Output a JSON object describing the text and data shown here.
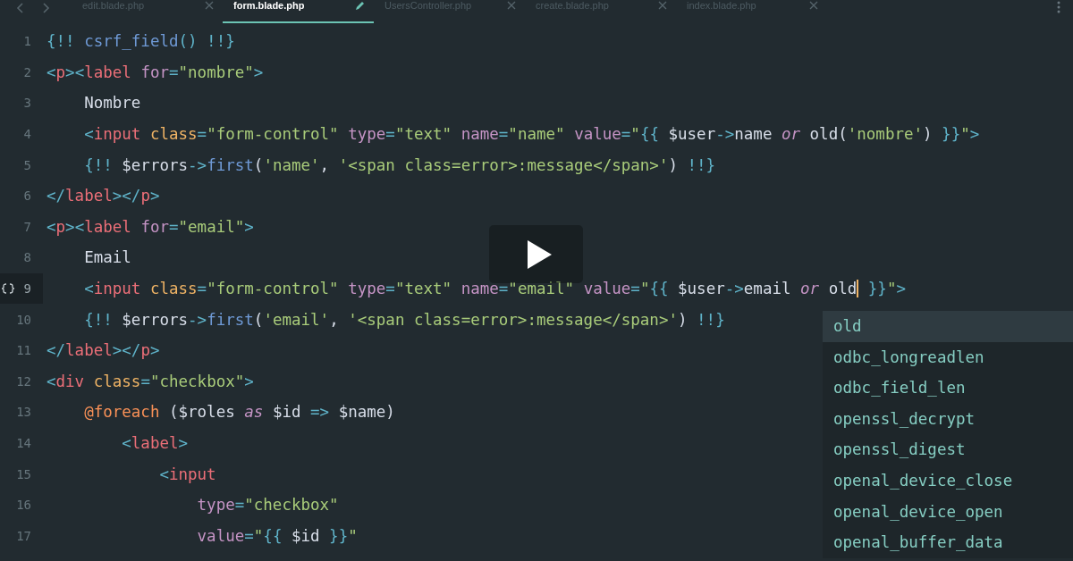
{
  "tabs": [
    {
      "label": "edit.blade.php",
      "selected": false,
      "modified": false
    },
    {
      "label": "form.blade.php",
      "selected": true,
      "modified": true
    },
    {
      "label": "UsersController.php",
      "selected": false,
      "modified": false
    },
    {
      "label": "create.blade.php",
      "selected": false,
      "modified": false
    },
    {
      "label": "index.blade.php",
      "selected": false,
      "modified": false
    }
  ],
  "lines": [
    {
      "number": "1",
      "current": false,
      "tokens": [
        {
          "t": "{!! ",
          "kind": "punct"
        },
        {
          "t": "csrf_field",
          "kind": "func"
        },
        {
          "t": "() !!}",
          "kind": "punct"
        }
      ]
    },
    {
      "number": "2",
      "current": false,
      "tokens": [
        {
          "t": "<",
          "kind": "punct"
        },
        {
          "t": "p",
          "kind": "tag"
        },
        {
          "t": "><",
          "kind": "punct"
        },
        {
          "t": "label ",
          "kind": "tag"
        },
        {
          "t": "for",
          "kind": "attr"
        },
        {
          "t": "=",
          "kind": "punct"
        },
        {
          "t": "\"nombre\"",
          "kind": "string"
        },
        {
          "t": ">",
          "kind": "punct"
        }
      ]
    },
    {
      "number": "3",
      "current": false,
      "tokens": [
        {
          "t": "    Nombre",
          "kind": "plain"
        }
      ]
    },
    {
      "number": "4",
      "current": false,
      "tokens": [
        {
          "t": "    <",
          "kind": "punct"
        },
        {
          "t": "input ",
          "kind": "tag"
        },
        {
          "t": "class",
          "kind": "classattr"
        },
        {
          "t": "=",
          "kind": "punct"
        },
        {
          "t": "\"form-control\" ",
          "kind": "string"
        },
        {
          "t": "type",
          "kind": "attr"
        },
        {
          "t": "=",
          "kind": "punct"
        },
        {
          "t": "\"text\" ",
          "kind": "string"
        },
        {
          "t": "name",
          "kind": "attr"
        },
        {
          "t": "=",
          "kind": "punct"
        },
        {
          "t": "\"name\" ",
          "kind": "string"
        },
        {
          "t": "value",
          "kind": "attr"
        },
        {
          "t": "=",
          "kind": "punct"
        },
        {
          "t": "\"",
          "kind": "string"
        },
        {
          "t": "{{ ",
          "kind": "punct"
        },
        {
          "t": "$user",
          "kind": "plain"
        },
        {
          "t": "->",
          "kind": "punct"
        },
        {
          "t": "name ",
          "kind": "plain"
        },
        {
          "t": "or",
          "kind": "keyword"
        },
        {
          "t": " old(",
          "kind": "plain"
        },
        {
          "t": "'nombre'",
          "kind": "string"
        },
        {
          "t": ") ",
          "kind": "plain"
        },
        {
          "t": "}}",
          "kind": "punct"
        },
        {
          "t": "\"",
          "kind": "string"
        },
        {
          "t": ">",
          "kind": "punct"
        }
      ]
    },
    {
      "number": "5",
      "current": false,
      "tokens": [
        {
          "t": "    {!! ",
          "kind": "punct"
        },
        {
          "t": "$errors",
          "kind": "plain"
        },
        {
          "t": "->",
          "kind": "punct"
        },
        {
          "t": "first",
          "kind": "func"
        },
        {
          "t": "(",
          "kind": "plain"
        },
        {
          "t": "'name'",
          "kind": "string"
        },
        {
          "t": ", ",
          "kind": "plain"
        },
        {
          "t": "'<span class=error>:message</span>'",
          "kind": "string"
        },
        {
          "t": ") ",
          "kind": "plain"
        },
        {
          "t": "!!}",
          "kind": "punct"
        }
      ]
    },
    {
      "number": "6",
      "current": false,
      "tokens": [
        {
          "t": "</",
          "kind": "punct"
        },
        {
          "t": "label",
          "kind": "tag"
        },
        {
          "t": "></",
          "kind": "punct"
        },
        {
          "t": "p",
          "kind": "tag"
        },
        {
          "t": ">",
          "kind": "punct"
        }
      ]
    },
    {
      "number": "7",
      "current": false,
      "tokens": [
        {
          "t": "<",
          "kind": "punct"
        },
        {
          "t": "p",
          "kind": "tag"
        },
        {
          "t": "><",
          "kind": "punct"
        },
        {
          "t": "label ",
          "kind": "tag"
        },
        {
          "t": "for",
          "kind": "attr"
        },
        {
          "t": "=",
          "kind": "punct"
        },
        {
          "t": "\"email\"",
          "kind": "string"
        },
        {
          "t": ">",
          "kind": "punct"
        }
      ]
    },
    {
      "number": "8",
      "current": false,
      "tokens": [
        {
          "t": "    Email",
          "kind": "plain"
        }
      ]
    },
    {
      "number": "9",
      "current": true,
      "tokens": [
        {
          "t": "    <",
          "kind": "punct"
        },
        {
          "t": "input ",
          "kind": "tag"
        },
        {
          "t": "class",
          "kind": "classattr"
        },
        {
          "t": "=",
          "kind": "punct"
        },
        {
          "t": "\"form-control\" ",
          "kind": "string"
        },
        {
          "t": "type",
          "kind": "attr"
        },
        {
          "t": "=",
          "kind": "punct"
        },
        {
          "t": "\"text\" ",
          "kind": "string"
        },
        {
          "t": "name",
          "kind": "attr"
        },
        {
          "t": "=",
          "kind": "punct"
        },
        {
          "t": "\"email\" ",
          "kind": "string"
        },
        {
          "t": "value",
          "kind": "attr"
        },
        {
          "t": "=",
          "kind": "punct"
        },
        {
          "t": "\"",
          "kind": "string"
        },
        {
          "t": "{{ ",
          "kind": "punct"
        },
        {
          "t": "$user",
          "kind": "plain"
        },
        {
          "t": "->",
          "kind": "punct"
        },
        {
          "t": "email ",
          "kind": "plain"
        },
        {
          "t": "or",
          "kind": "keyword"
        },
        {
          "t": " old",
          "kind": "plain",
          "caret": true
        },
        {
          "t": " }}",
          "kind": "punct"
        },
        {
          "t": "\"",
          "kind": "string"
        },
        {
          "t": ">",
          "kind": "punct"
        }
      ]
    },
    {
      "number": "10",
      "current": false,
      "tokens": [
        {
          "t": "    {!! ",
          "kind": "punct"
        },
        {
          "t": "$errors",
          "kind": "plain"
        },
        {
          "t": "->",
          "kind": "punct"
        },
        {
          "t": "first",
          "kind": "func"
        },
        {
          "t": "(",
          "kind": "plain"
        },
        {
          "t": "'email'",
          "kind": "string"
        },
        {
          "t": ", ",
          "kind": "plain"
        },
        {
          "t": "'<span class=error>:message</span>'",
          "kind": "string"
        },
        {
          "t": ") ",
          "kind": "plain"
        },
        {
          "t": "!!}",
          "kind": "punct"
        }
      ]
    },
    {
      "number": "11",
      "current": false,
      "tokens": [
        {
          "t": "</",
          "kind": "punct"
        },
        {
          "t": "label",
          "kind": "tag"
        },
        {
          "t": "></",
          "kind": "punct"
        },
        {
          "t": "p",
          "kind": "tag"
        },
        {
          "t": ">",
          "kind": "punct"
        }
      ]
    },
    {
      "number": "12",
      "current": false,
      "tokens": [
        {
          "t": "<",
          "kind": "punct"
        },
        {
          "t": "div ",
          "kind": "tag"
        },
        {
          "t": "class",
          "kind": "classattr"
        },
        {
          "t": "=",
          "kind": "punct"
        },
        {
          "t": "\"checkbox\"",
          "kind": "string"
        },
        {
          "t": ">",
          "kind": "punct"
        }
      ]
    },
    {
      "number": "13",
      "current": false,
      "tokens": [
        {
          "t": "    @foreach",
          "kind": "directive"
        },
        {
          "t": " ($roles ",
          "kind": "plain"
        },
        {
          "t": "as",
          "kind": "keyword"
        },
        {
          "t": " $id ",
          "kind": "plain"
        },
        {
          "t": "=>",
          "kind": "punct"
        },
        {
          "t": " $name)",
          "kind": "plain"
        }
      ]
    },
    {
      "number": "14",
      "current": false,
      "tokens": [
        {
          "t": "        <",
          "kind": "punct"
        },
        {
          "t": "label",
          "kind": "tag"
        },
        {
          "t": ">",
          "kind": "punct"
        }
      ]
    },
    {
      "number": "15",
      "current": false,
      "tokens": [
        {
          "t": "            <",
          "kind": "punct"
        },
        {
          "t": "input",
          "kind": "tag"
        }
      ]
    },
    {
      "number": "16",
      "current": false,
      "tokens": [
        {
          "t": "                type",
          "kind": "attr"
        },
        {
          "t": "=",
          "kind": "punct"
        },
        {
          "t": "\"checkbox\"",
          "kind": "string"
        }
      ]
    },
    {
      "number": "17",
      "current": false,
      "tokens": [
        {
          "t": "                value",
          "kind": "attr"
        },
        {
          "t": "=",
          "kind": "punct"
        },
        {
          "t": "\"",
          "kind": "string"
        },
        {
          "t": "{{ ",
          "kind": "punct"
        },
        {
          "t": "$id",
          "kind": "plain"
        },
        {
          "t": " }}",
          "kind": "punct"
        },
        {
          "t": "\"",
          "kind": "string"
        }
      ]
    }
  ],
  "completions": [
    {
      "label": "old",
      "selected": true
    },
    {
      "label": "odbc_longreadlen",
      "selected": false
    },
    {
      "label": "odbc_field_len",
      "selected": false
    },
    {
      "label": "openssl_decrypt",
      "selected": false
    },
    {
      "label": "openssl_digest",
      "selected": false
    },
    {
      "label": "openal_device_close",
      "selected": false
    },
    {
      "label": "openal_device_open",
      "selected": false
    },
    {
      "label": "openal_buffer_data",
      "selected": false
    }
  ]
}
